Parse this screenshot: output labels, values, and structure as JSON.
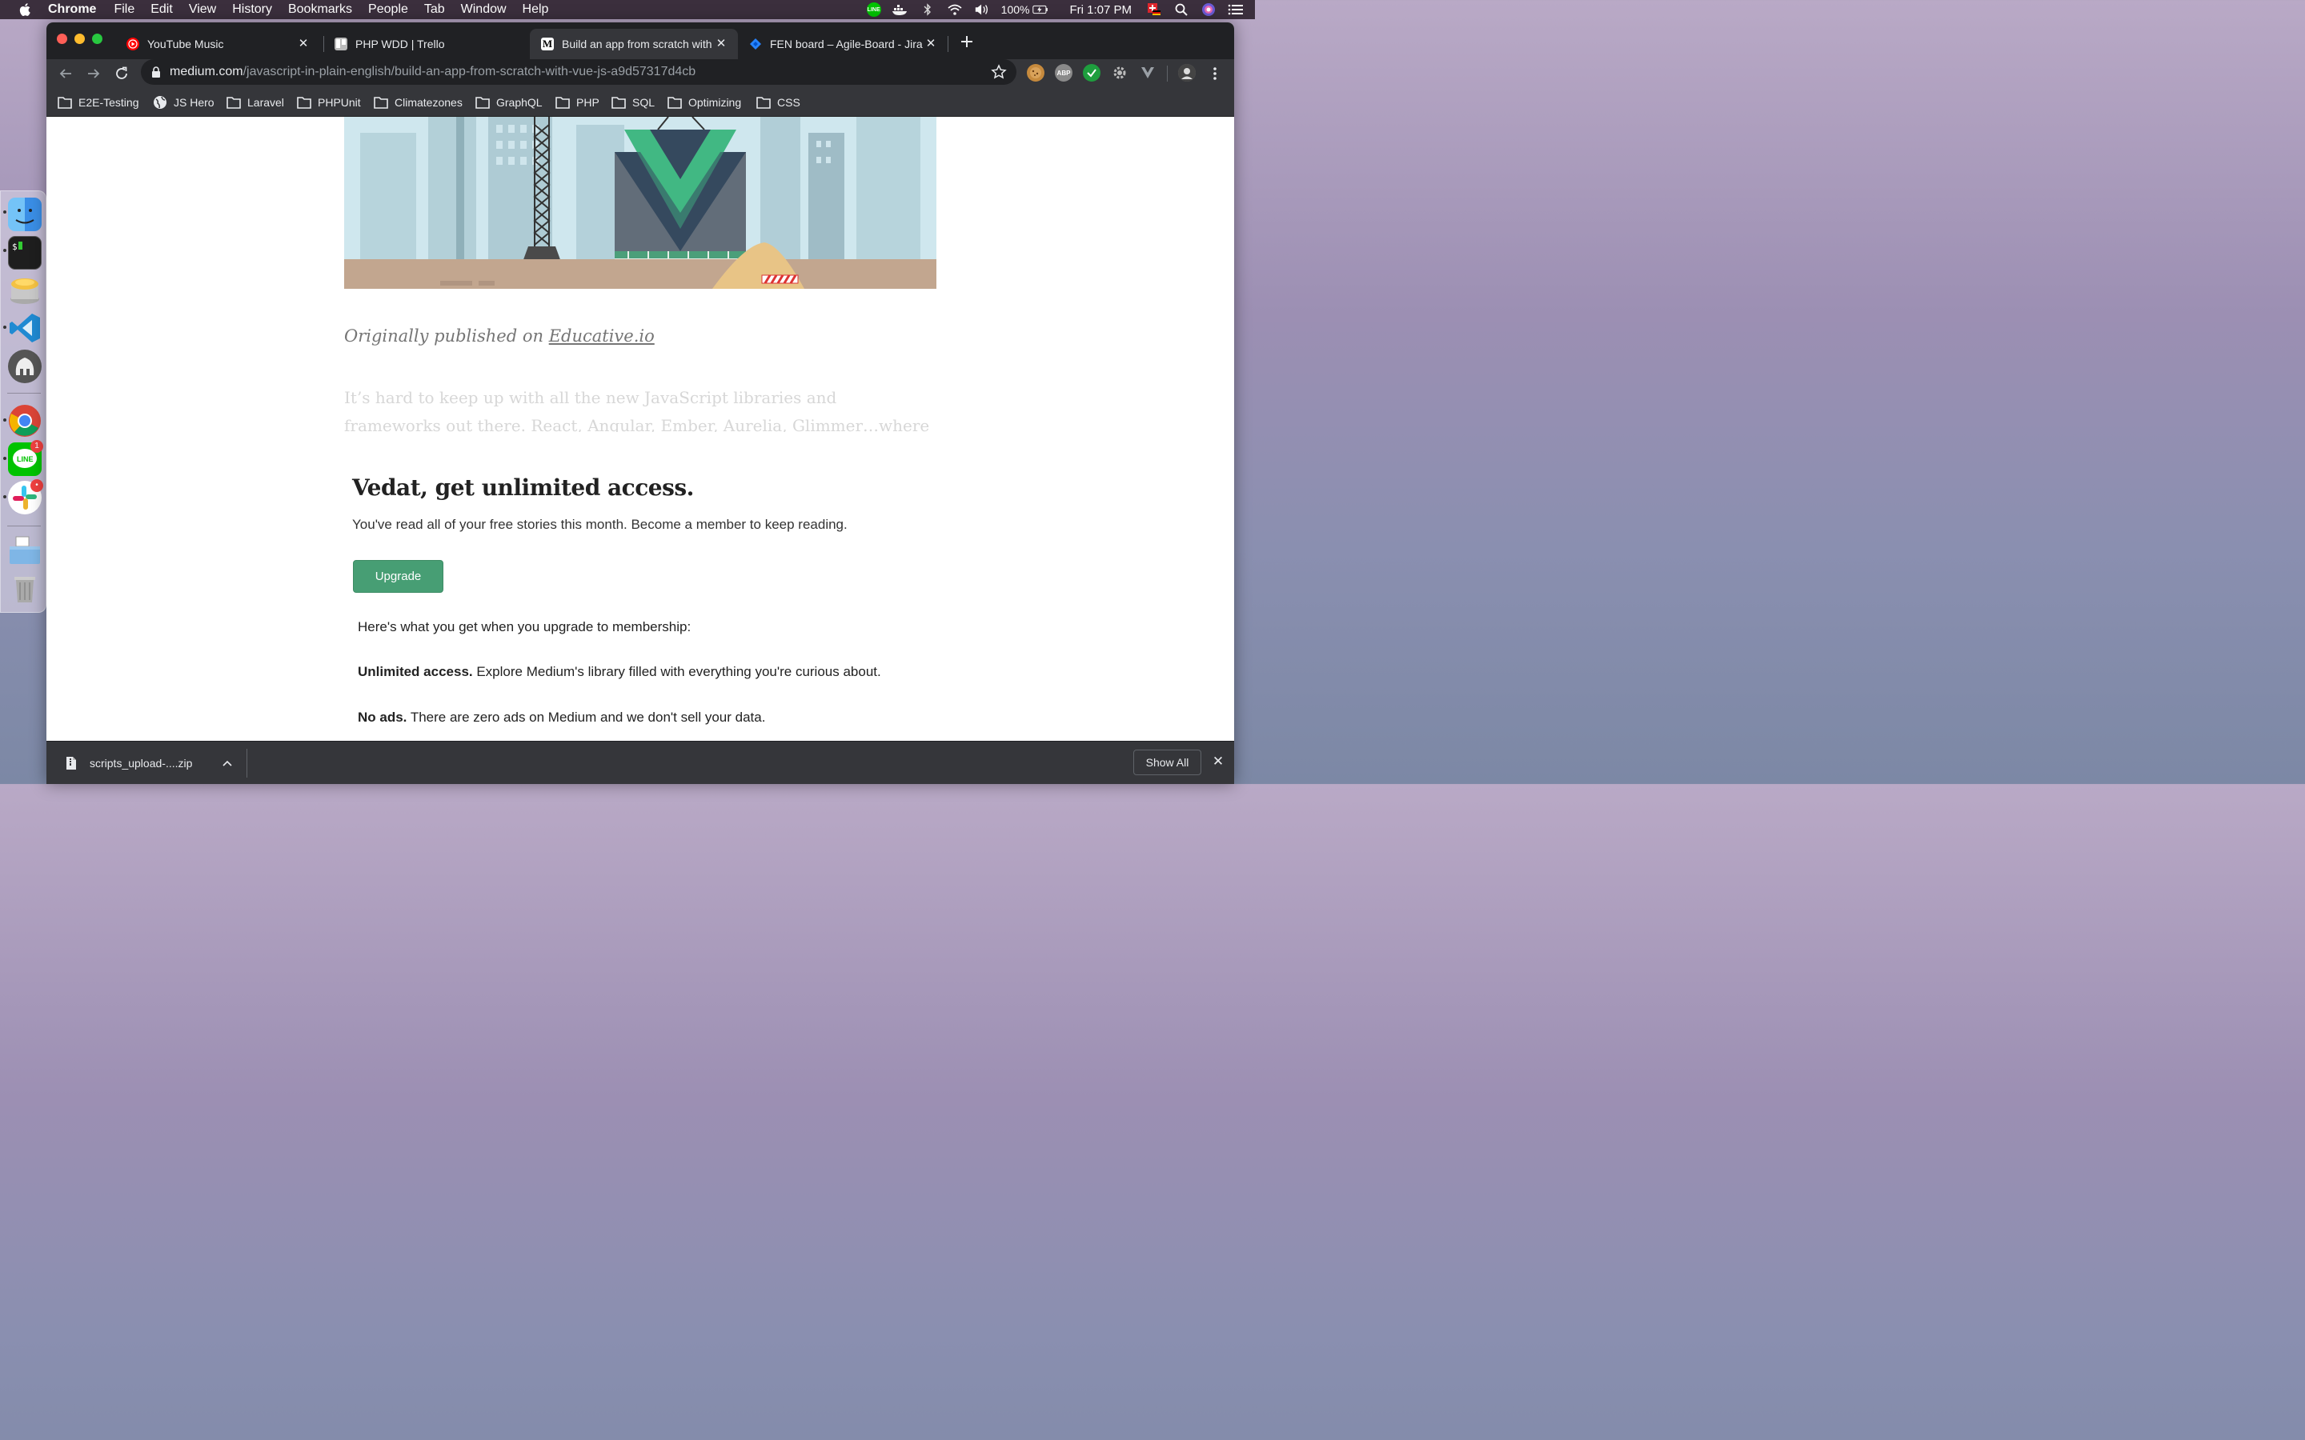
{
  "menubar": {
    "app_name": "Chrome",
    "menus": [
      "File",
      "Edit",
      "View",
      "History",
      "Bookmarks",
      "People",
      "Tab",
      "Window",
      "Help"
    ],
    "battery": "100%",
    "clock": "Fri 1:07 PM",
    "line_label": "LINE"
  },
  "dock": {
    "line_badge": "1",
    "slack_badge": "•"
  },
  "tabs": [
    {
      "title": "YouTube Music",
      "icon": "youtube-music-icon"
    },
    {
      "title": "PHP WDD | Trello",
      "icon": "trello-icon"
    },
    {
      "title": "Build an app from scratch with",
      "icon": "medium-icon",
      "favicon_text": "M"
    },
    {
      "title": "FEN board – Agile-Board - Jira",
      "icon": "jira-icon"
    }
  ],
  "omnibox": {
    "host": "medium.com",
    "path": "/javascript-in-plain-english/build-an-app-from-scratch-with-vue-js-a9d57317d4cb"
  },
  "extensions": {
    "abp_label": "ABP"
  },
  "bookmarks": [
    {
      "label": "E2E-Testing",
      "icon": "folder-icon"
    },
    {
      "label": "JS Hero",
      "icon": "globe-icon"
    },
    {
      "label": "Laravel",
      "icon": "folder-icon"
    },
    {
      "label": "PHPUnit",
      "icon": "folder-icon"
    },
    {
      "label": "Climatezones",
      "icon": "folder-icon"
    },
    {
      "label": "GraphQL",
      "icon": "folder-icon"
    },
    {
      "label": "PHP",
      "icon": "folder-icon"
    },
    {
      "label": "SQL",
      "icon": "folder-icon"
    },
    {
      "label": "Optimizing",
      "icon": "folder-icon"
    },
    {
      "label": "CSS",
      "icon": "folder-icon"
    }
  ],
  "article": {
    "caption_prefix": "Originally published on ",
    "caption_link": "Educative.io",
    "faded_text": "It’s hard to keep up with all the new JavaScript libraries and frameworks out there. React, Angular, Ember, Aurelia, Glimmer…where do you start?"
  },
  "paywall": {
    "title": "Vedat, get unlimited access.",
    "subtitle": "You've read all of your free stories this month. Become a member to keep reading.",
    "button": "Upgrade",
    "benefits_heading": "Here's what you get when you upgrade to membership:",
    "benefits": [
      {
        "bold": "Unlimited access.",
        "text": " Explore Medium's library filled with everything you're curious about."
      },
      {
        "bold": "No ads.",
        "text": " There are zero ads on Medium and we don't sell your data."
      }
    ]
  },
  "downloads": {
    "file_name": "scripts_upload-....zip",
    "show_all": "Show All"
  },
  "colors": {
    "accent_green": "#479e74",
    "chrome_dark": "#35363a",
    "chrome_darker": "#202124"
  }
}
